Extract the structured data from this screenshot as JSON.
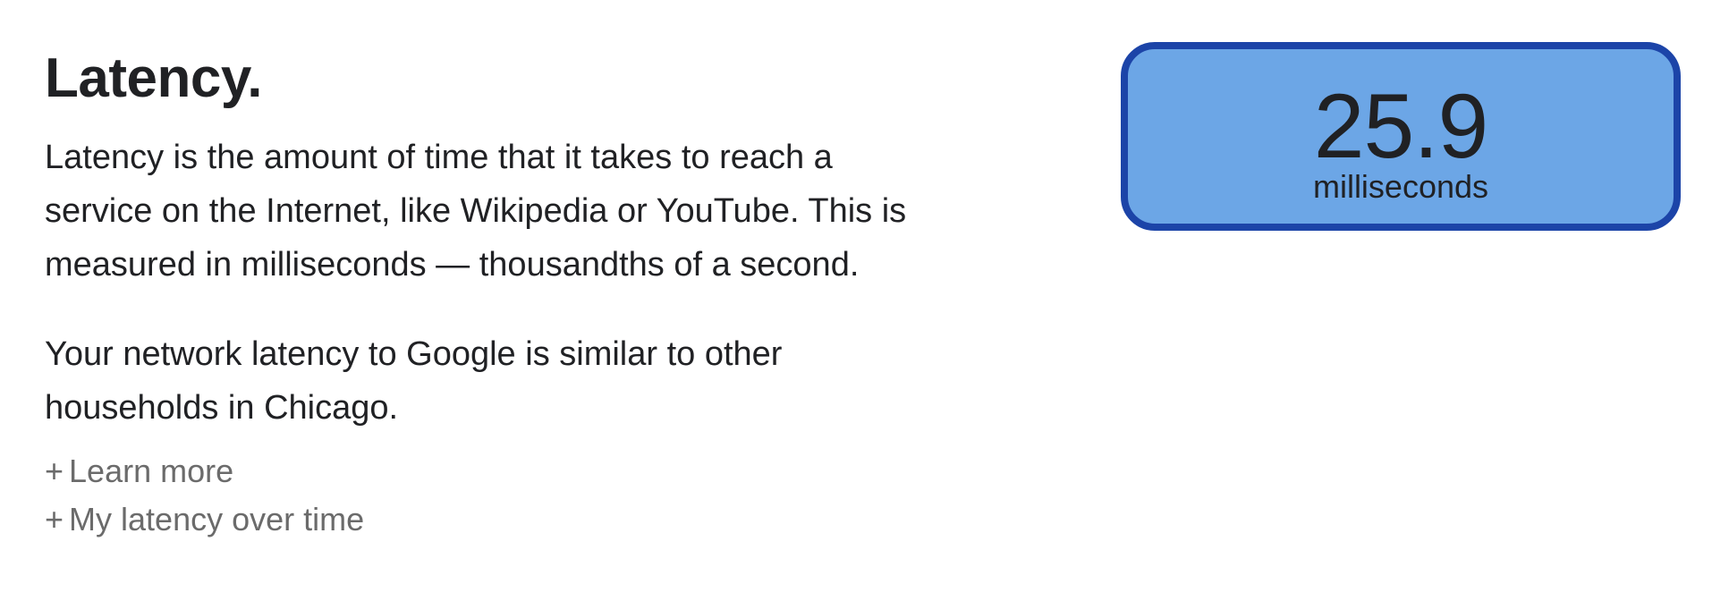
{
  "section": {
    "title": "Latency.",
    "description": "Latency is the amount of time that it takes to reach a service on the Internet, like Wikipedia or YouTube. This is measured in milliseconds — thousandths of a second.",
    "comparison": "Your network latency to Google is similar to other households in Chicago."
  },
  "links": {
    "learn_more": {
      "prefix": "+",
      "label": "Learn more"
    },
    "over_time": {
      "prefix": "+",
      "label": "My latency over time"
    }
  },
  "metric": {
    "value": "25.9",
    "unit": "milliseconds"
  },
  "colors": {
    "card_fill": "#6ca6e6",
    "card_border": "#1c44a8",
    "text": "#202124",
    "link": "#6b6b6b"
  }
}
